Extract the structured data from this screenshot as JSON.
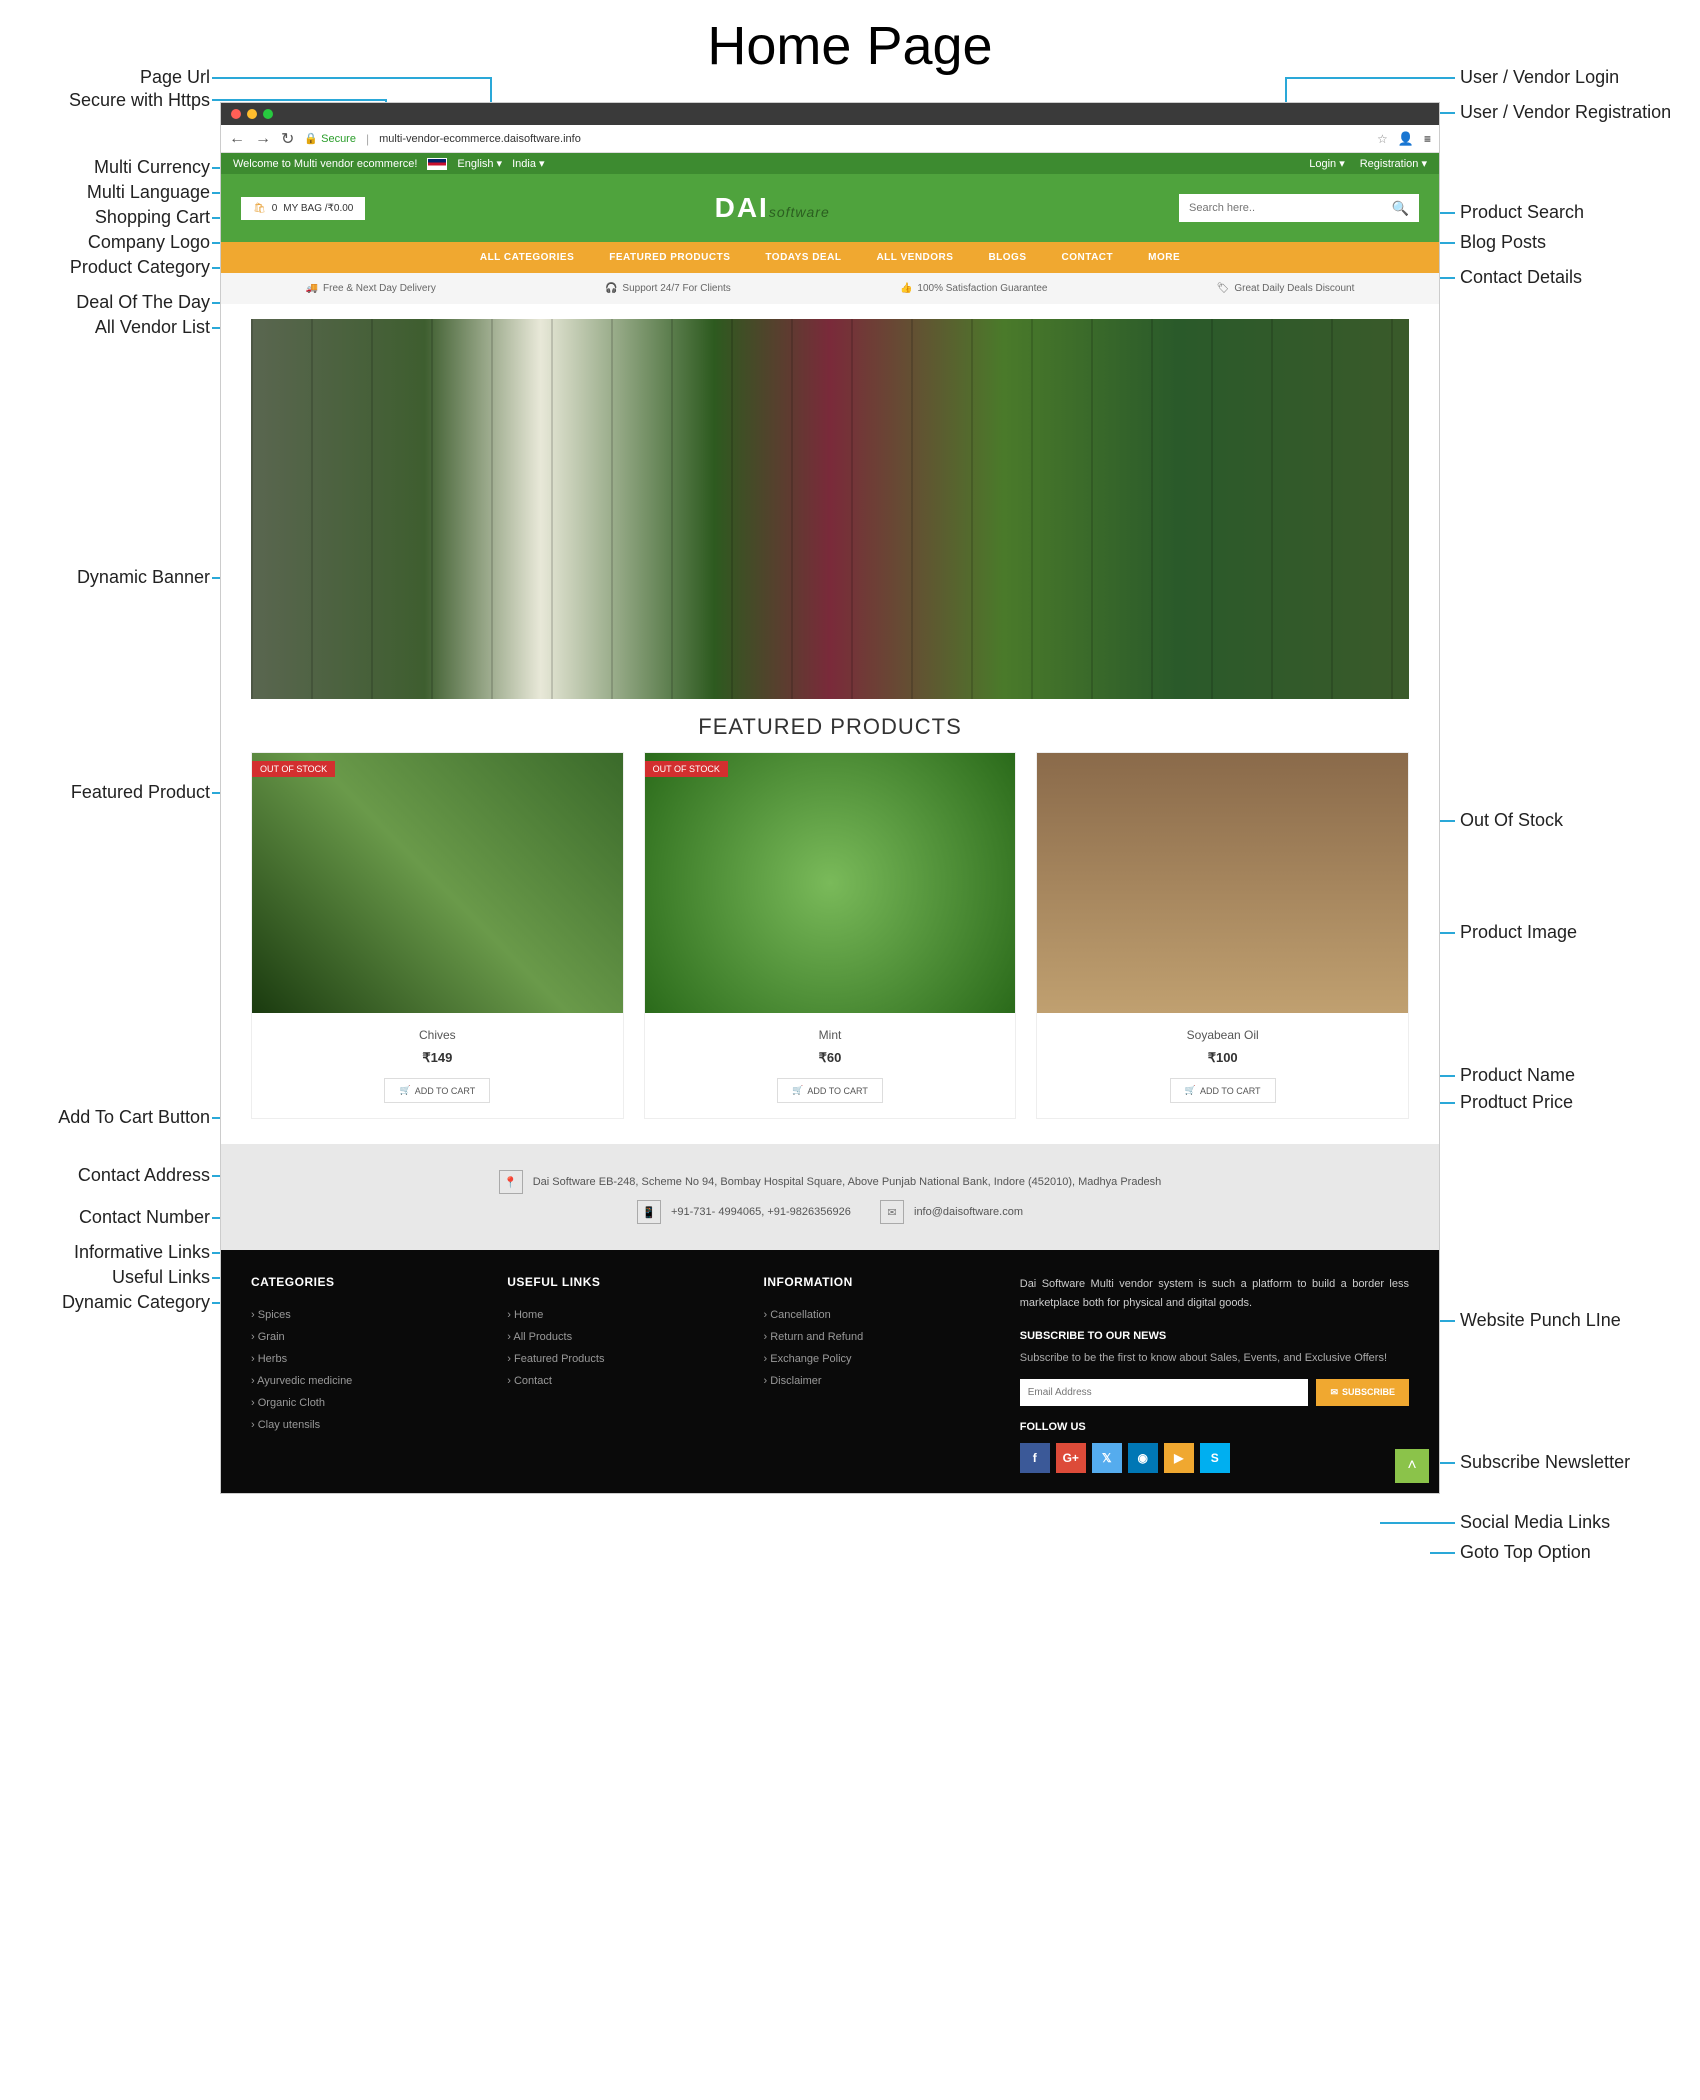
{
  "page_heading": "Home Page",
  "browser": {
    "url": "multi-vendor-ecommerce.daisoftware.info",
    "secure_label": "Secure"
  },
  "topstrip": {
    "welcome": "Welcome to Multi vendor ecommerce!",
    "language": "English",
    "currency": "India",
    "login": "Login",
    "register": "Registration"
  },
  "header": {
    "cart_count": "0",
    "cart_label": "MY BAG /₹0.00",
    "logo_main": "DAI",
    "logo_sub": "software",
    "search_placeholder": "Search here.."
  },
  "nav": {
    "all_categories": "ALL CATEGORIES",
    "featured": "FEATURED PRODUCTS",
    "todays_deal": "TODAYS DEAL",
    "all_vendors": "ALL VENDORS",
    "blogs": "BLOGS",
    "contact": "CONTACT",
    "more": "MORE"
  },
  "benefits": {
    "b1": "Free & Next Day Delivery",
    "b2": "Support 24/7 For Clients",
    "b3": "100% Satisfaction Guarantee",
    "b4": "Great Daily Deals Discount"
  },
  "featured_title": "FEATURED PRODUCTS",
  "out_of_stock_label": "OUT OF STOCK",
  "add_to_cart_label": "ADD TO CART",
  "products": [
    {
      "name": "Chives",
      "price": "₹149",
      "out_of_stock": true
    },
    {
      "name": "Mint",
      "price": "₹60",
      "out_of_stock": true
    },
    {
      "name": "Soyabean Oil",
      "price": "₹100",
      "out_of_stock": false
    }
  ],
  "contact": {
    "address": "Dai Software EB-248, Scheme No 94, Bombay Hospital Square, Above Punjab National Bank, Indore (452010), Madhya Pradesh",
    "phones": "+91-731- 4994065, +91-9826356926",
    "email": "info@daisoftware.com"
  },
  "footer": {
    "categories_head": "CATEGORIES",
    "categories": [
      "Spices",
      "Grain",
      "Herbs",
      "Ayurvedic medicine",
      "Organic Cloth",
      "Clay utensils"
    ],
    "useful_head": "USEFUL LINKS",
    "useful": [
      "Home",
      "All Products",
      "Featured Products",
      "Contact"
    ],
    "info_head": "INFORMATION",
    "info": [
      "Cancellation",
      "Return and Refund",
      "Exchange Policy",
      "Disclaimer"
    ],
    "punchline": "Dai Software Multi vendor system is such a platform to build a border less marketplace both for physical and digital goods.",
    "subscribe_head": "SUBSCRIBE TO OUR NEWS",
    "subscribe_text": "Subscribe to be the first to know about Sales, Events, and Exclusive Offers!",
    "email_placeholder": "Email Address",
    "subscribe_btn": "SUBSCRIBE",
    "follow_head": "FOLLOW US"
  },
  "annotations": {
    "left": {
      "page_url": "Page Url",
      "secure_https": "Secure with Https",
      "multi_currency": "Multi Currency",
      "multi_language": "Multi Language",
      "shopping_cart": "Shopping Cart",
      "company_logo": "Company Logo",
      "product_category": "Product Category",
      "deal_of_day": "Deal Of The Day",
      "all_vendor_list": "All Vendor List",
      "dynamic_banner": "Dynamic Banner",
      "featured_product": "Featured Product",
      "add_to_cart": "Add To Cart Button",
      "contact_address": "Contact Address",
      "contact_number": "Contact Number",
      "informative_links": "Informative Links",
      "useful_links_ann": "Useful Links",
      "dynamic_category": "Dynamic Category"
    },
    "right": {
      "user_login": "User / Vendor Login",
      "user_register": "User / Vendor Registration",
      "product_search": "Product Search",
      "blog_posts": "Blog Posts",
      "contact_details": "Contact Details",
      "out_of_stock": "Out Of Stock",
      "product_image": "Product Image",
      "product_name": "Product Name",
      "product_price": "Prodtuct Price",
      "punchline_ann": "Website Punch LIne",
      "subscribe_news": "Subscribe Newsletter",
      "social_media": "Social Media Links",
      "goto_top": "Goto Top Option"
    }
  }
}
